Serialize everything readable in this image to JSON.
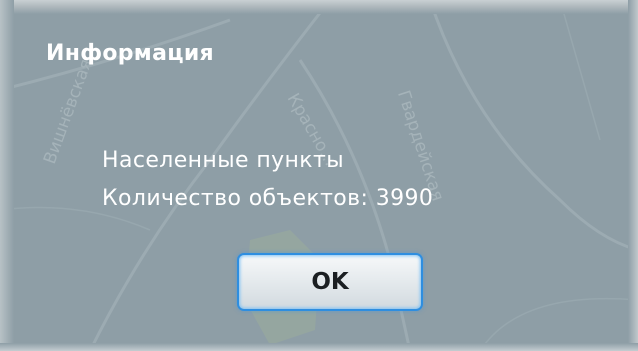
{
  "dialog": {
    "title": "Информация",
    "message_line_1": "Населенные пункты",
    "message_line_2": "Количество объектов: 3990",
    "ok_label": "OK"
  },
  "background_map": {
    "street_labels": [
      "Вишнёвская",
      "Красно...",
      "Гвардейская"
    ]
  },
  "colors": {
    "backdrop": "#8e9ea6",
    "text": "#ffffff",
    "button_border": "#2e8ee0"
  }
}
